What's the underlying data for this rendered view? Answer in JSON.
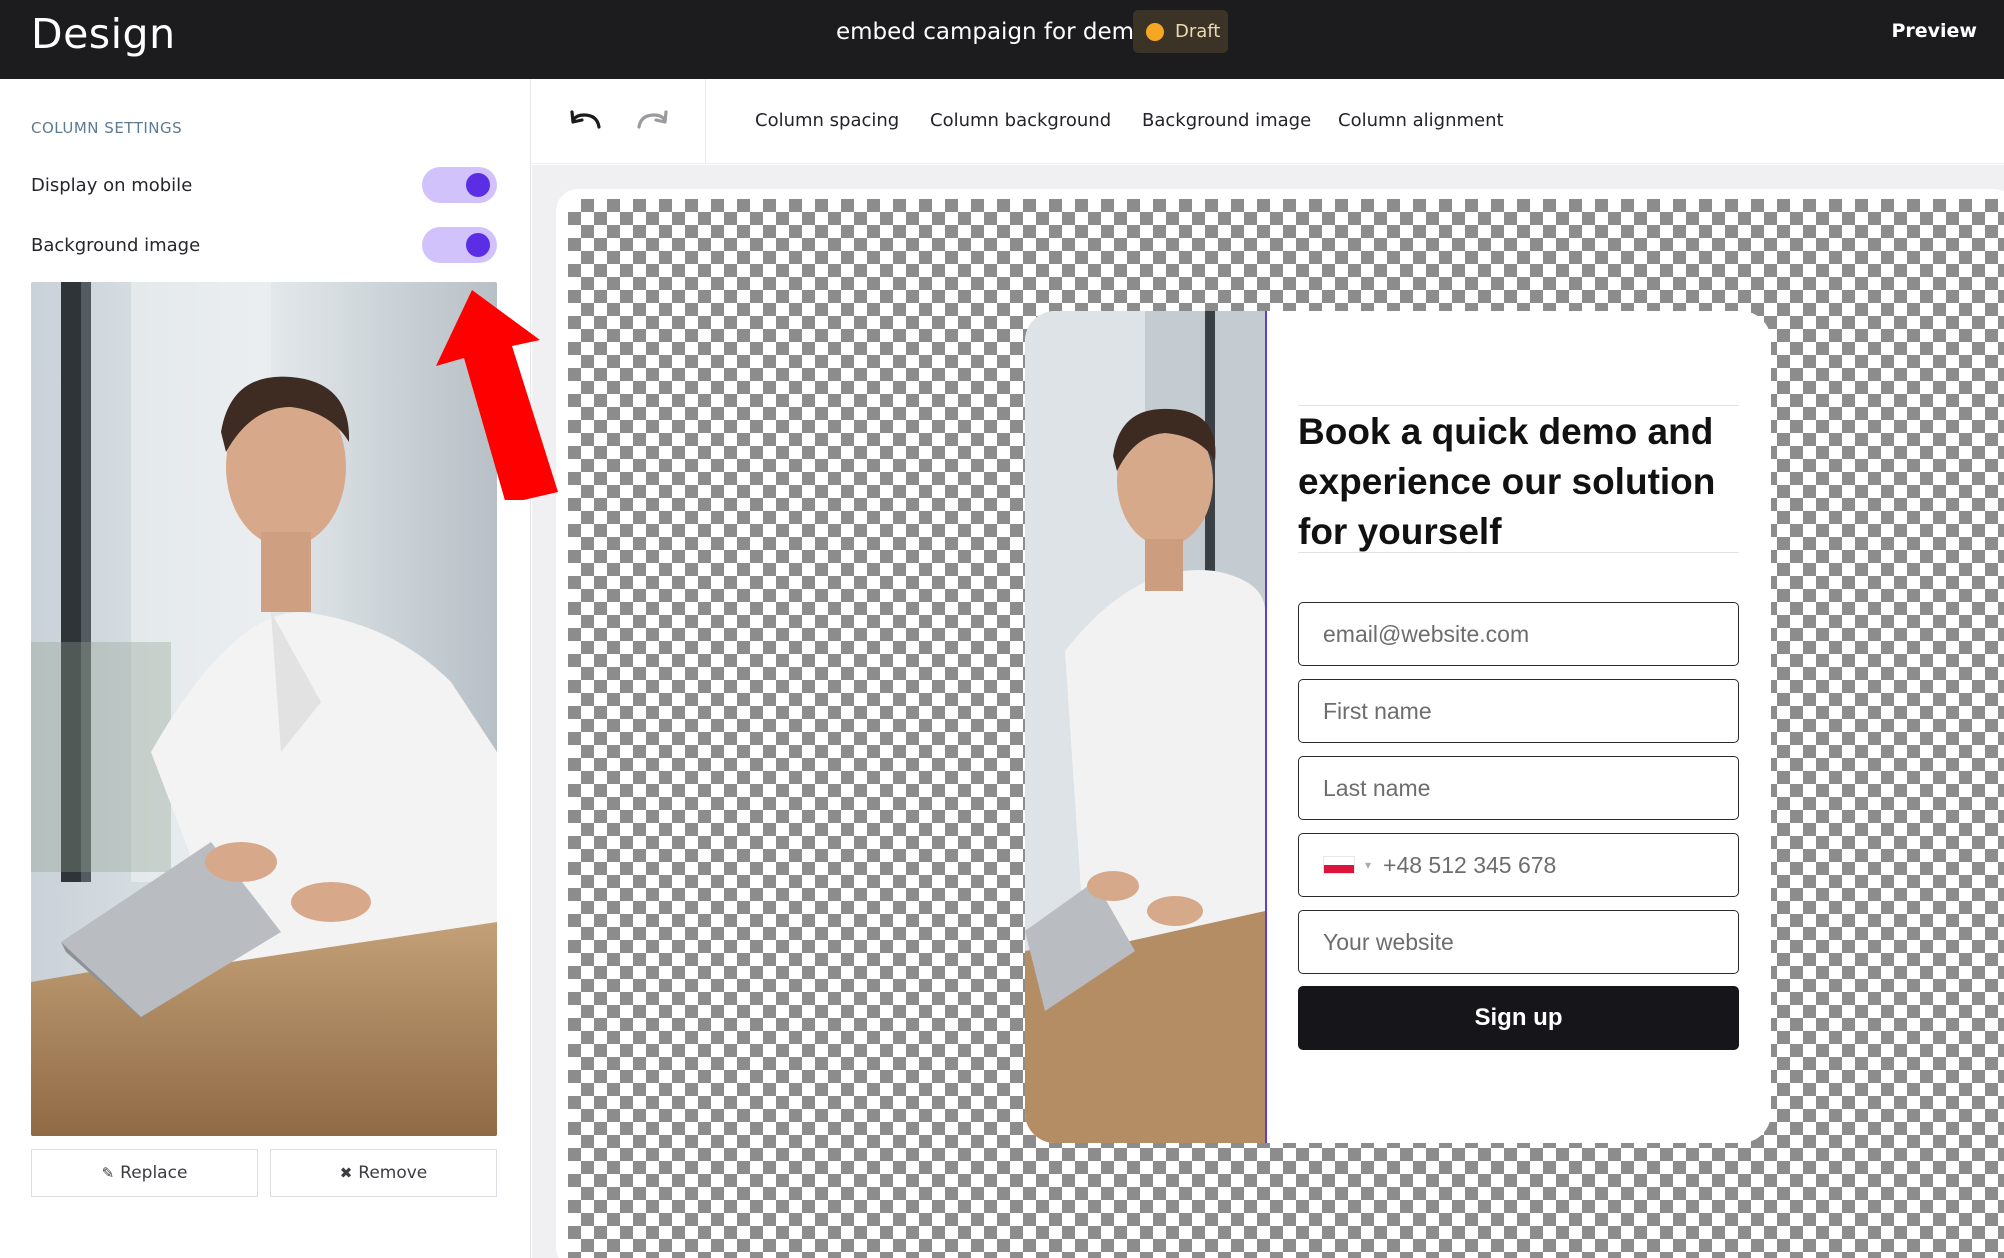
{
  "app": {
    "title": "Design"
  },
  "header": {
    "campaign_name": "embed campaign for demo",
    "status_badge": "Draft",
    "preview_label": "Preview"
  },
  "sidebar": {
    "section_title": "COLUMN SETTINGS",
    "settings": [
      {
        "label": "Display on mobile",
        "enabled": true
      },
      {
        "label": "Background image",
        "enabled": true
      }
    ],
    "replace_label": "Replace",
    "remove_label": "Remove"
  },
  "toolbar": {
    "undo_icon": "undo-icon",
    "redo_icon": "redo-icon",
    "tabs": [
      "Column spacing",
      "Column background",
      "Background image",
      "Column alignment"
    ]
  },
  "form": {
    "headline": "Book a quick demo and experience our solution for yourself",
    "fields": {
      "email_placeholder": "email@website.com",
      "first_name_placeholder": "First name",
      "last_name_placeholder": "Last name",
      "phone_placeholder": "+48 512 345 678",
      "website_placeholder": "Your website"
    },
    "submit_label": "Sign up"
  },
  "colors": {
    "topbar": "#1c1c1f",
    "accent_purple": "#5b2ee6",
    "toggle_track": "#d2c2fb",
    "draft_dot": "#f5a623",
    "annotation_arrow": "#ff0000"
  }
}
